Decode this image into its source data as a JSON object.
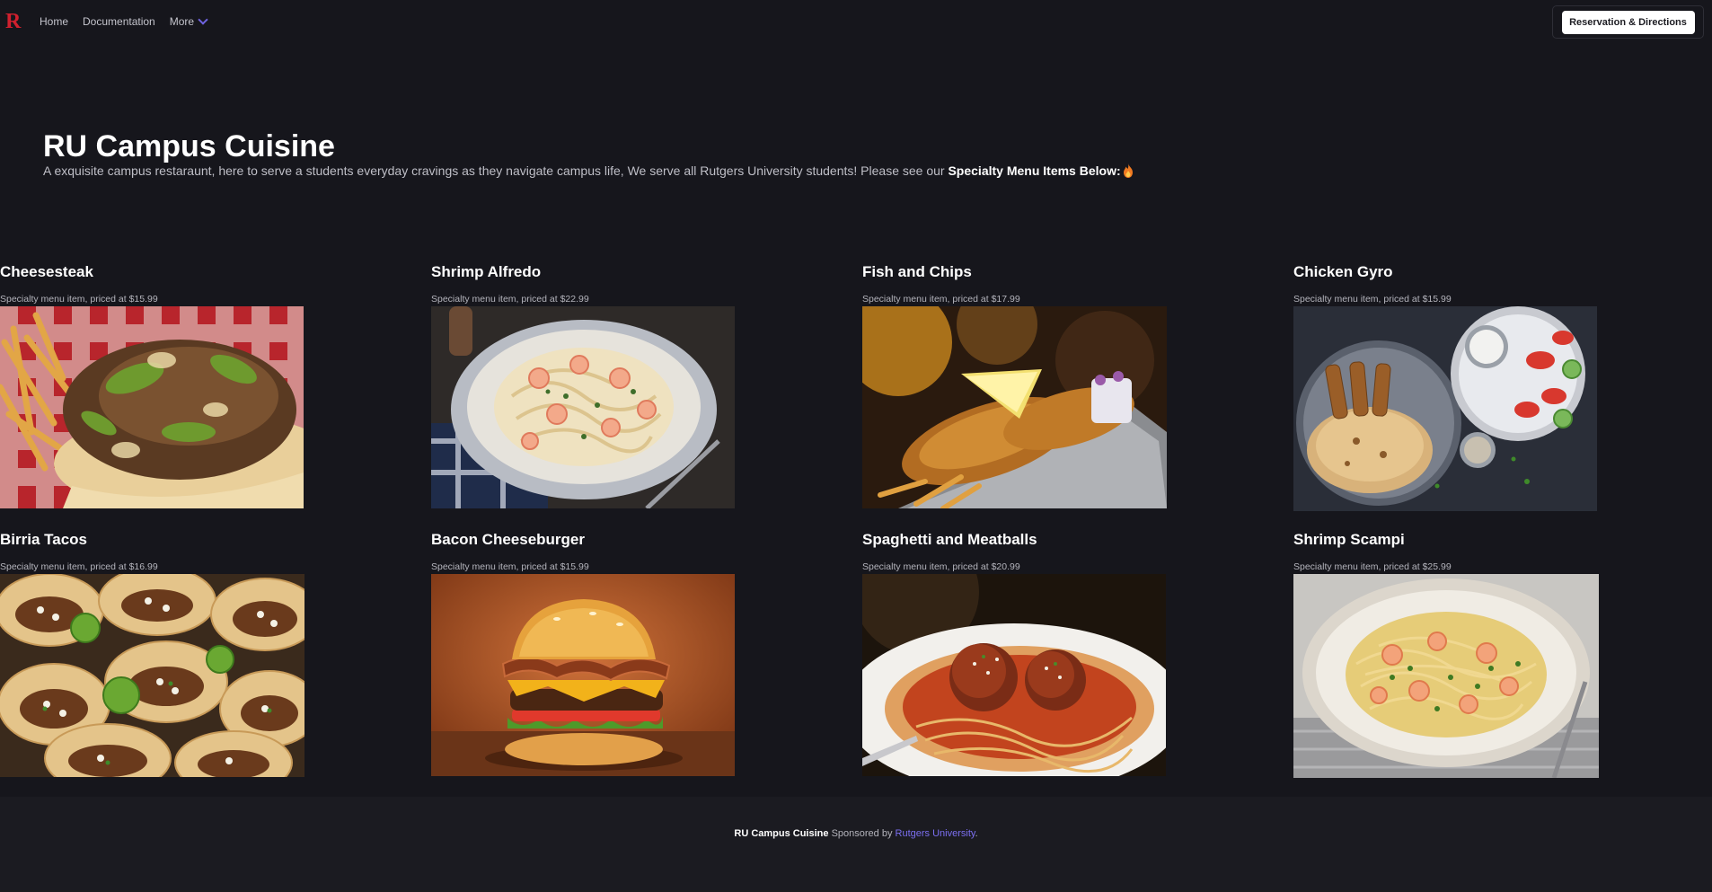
{
  "nav": {
    "logo": "R",
    "home": "Home",
    "documentation": "Documentation",
    "more": "More",
    "reserve_button": "Reservation & Directions"
  },
  "hero": {
    "title": "RU Campus Cuisine",
    "subtitle": "A exquisite campus restaraunt, here to serve a students everyday cravings as they navigate campus life, We serve all Rutgers University students! Please see our ",
    "subtitle_bold": "Specialty Menu Items Below:"
  },
  "menu": {
    "items": [
      {
        "name": "Cheesesteak",
        "price_text": "Specialty menu item, priced at $15.99"
      },
      {
        "name": "Shrimp Alfredo",
        "price_text": "Specialty menu item, priced at $22.99"
      },
      {
        "name": "Fish and Chips",
        "price_text": "Specialty menu item, priced at $17.99"
      },
      {
        "name": "Chicken Gyro",
        "price_text": "Specialty menu item, priced at $15.99"
      },
      {
        "name": "Birria Tacos",
        "price_text": "Specialty menu item, priced at $16.99"
      },
      {
        "name": "Bacon Cheeseburger",
        "price_text": "Specialty menu item, priced at $15.99"
      },
      {
        "name": "Spaghetti and Meatballs",
        "price_text": "Specialty menu item, priced at $20.99"
      },
      {
        "name": "Shrimp Scampi",
        "price_text": "Specialty menu item, priced at $25.99"
      }
    ]
  },
  "footer": {
    "brand": "RU Campus Cuisine",
    "sponsored": " Sponsored by ",
    "link": "Rutgers University",
    "period": "."
  },
  "colors": {
    "background": "#16161c",
    "logo_red": "#d0202e",
    "accent": "#7b6ff0"
  }
}
